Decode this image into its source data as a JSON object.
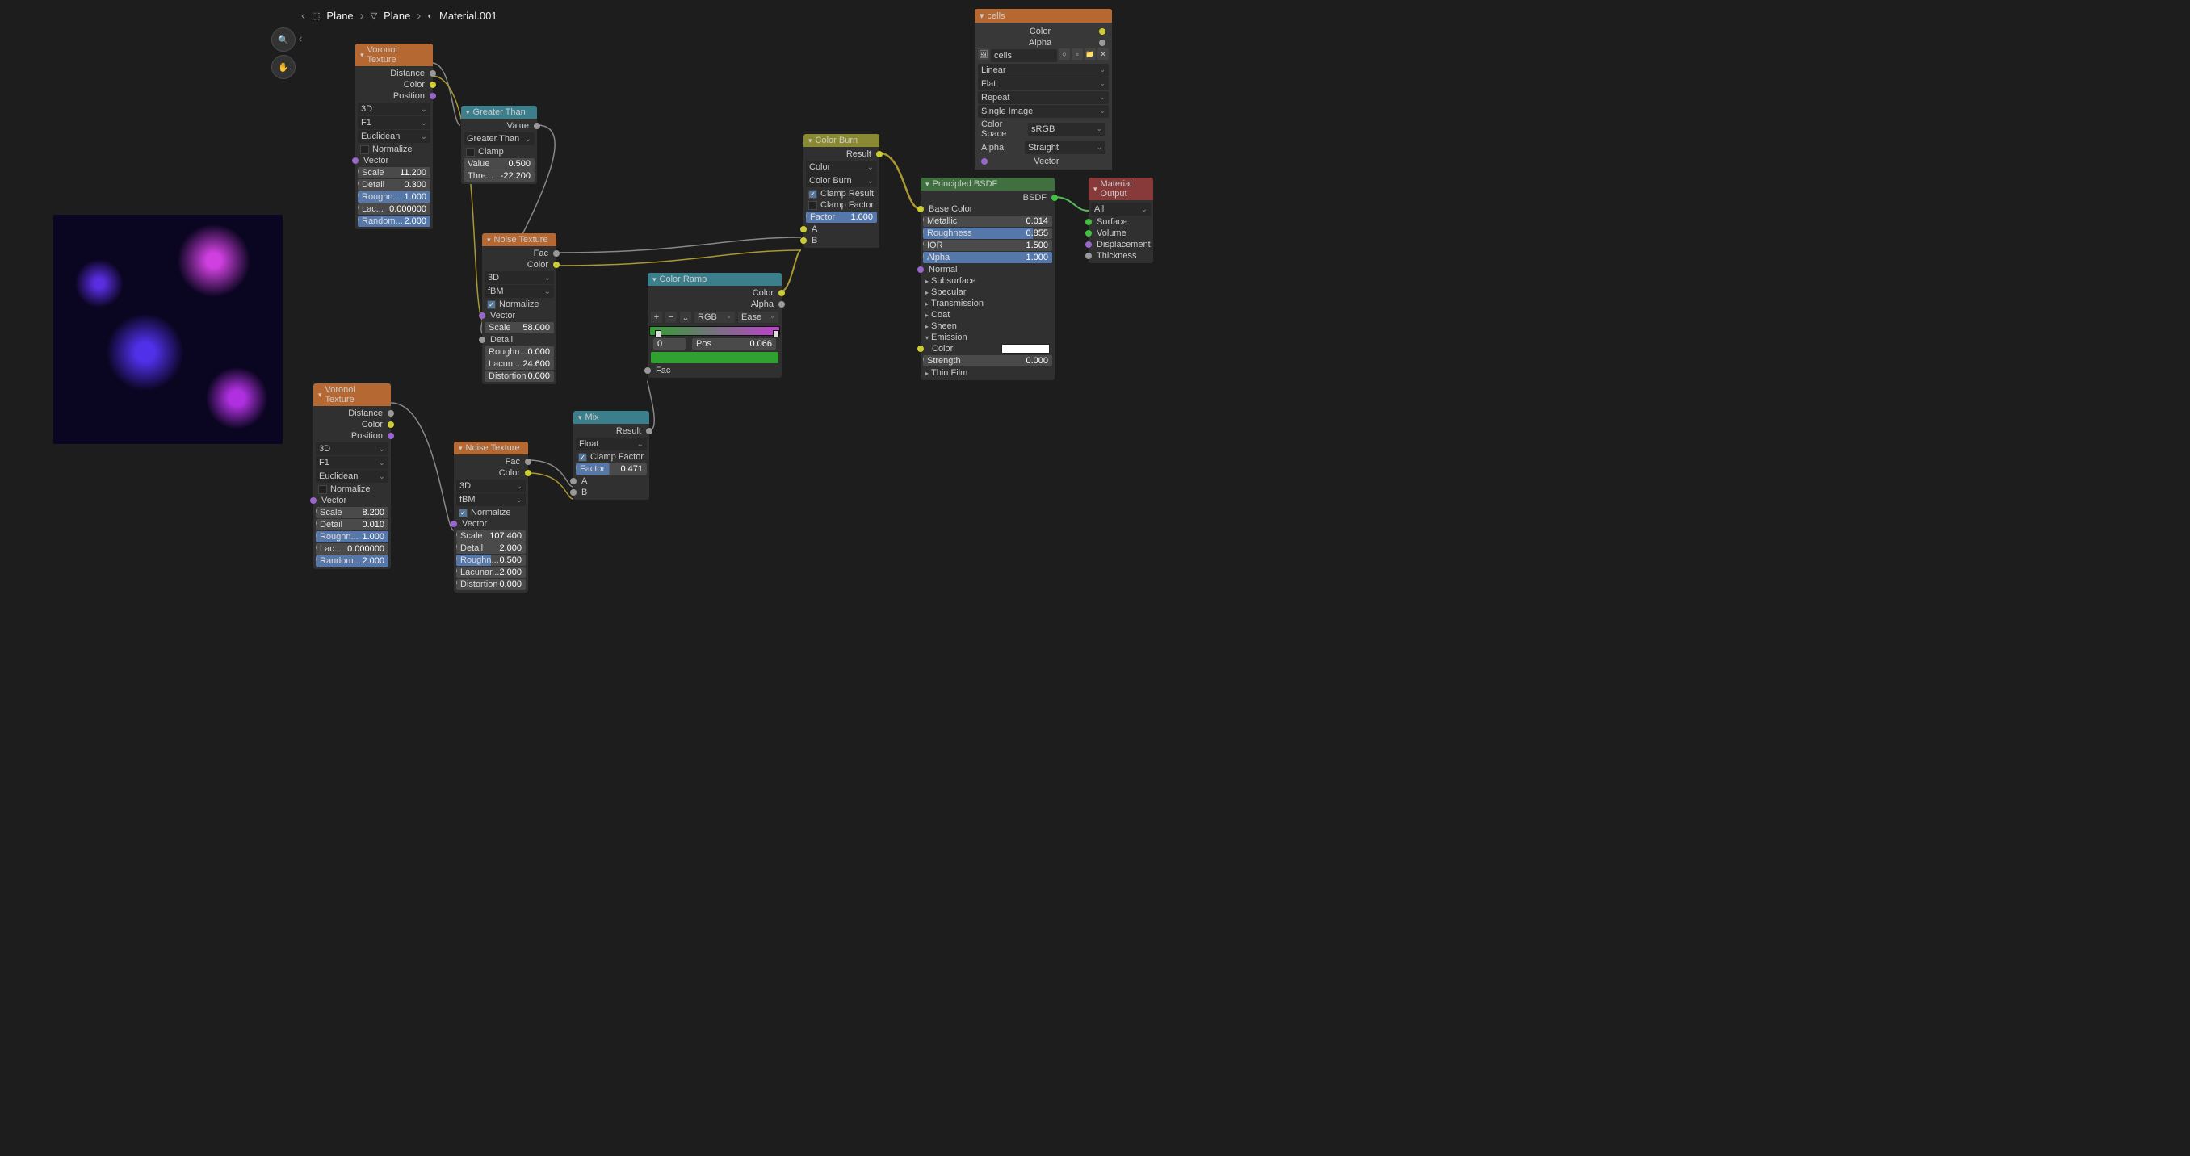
{
  "breadcrumb": {
    "item1": "Plane",
    "item2": "Plane",
    "item3": "Material.001"
  },
  "panel": {
    "title": "cells",
    "color_lbl": "Color",
    "alpha_lbl": "Alpha",
    "image_name": "cells",
    "interp": "Linear",
    "proj": "Flat",
    "ext": "Repeat",
    "frame": "Single Image",
    "cs_lbl": "Color Space",
    "cs_val": "sRGB",
    "alpha_mode_lbl": "Alpha",
    "alpha_mode_val": "Straight",
    "vector_lbl": "Vector"
  },
  "voronoi1": {
    "title": "Voronoi Texture",
    "distance": "Distance",
    "color": "Color",
    "position": "Position",
    "dim": "3D",
    "feat": "F1",
    "metric": "Euclidean",
    "normalize": "Normalize",
    "vector": "Vector",
    "scale_lbl": "Scale",
    "scale": "11.200",
    "detail_lbl": "Detail",
    "detail": "0.300",
    "rough_lbl": "Roughn...",
    "rough": "1.000",
    "lac_lbl": "Lac...",
    "lac": "0.000000",
    "rand_lbl": "Random...",
    "rand": "2.000"
  },
  "voronoi2": {
    "title": "Voronoi Texture",
    "distance": "Distance",
    "color": "Color",
    "position": "Position",
    "dim": "3D",
    "feat": "F1",
    "metric": "Euclidean",
    "normalize": "Normalize",
    "vector": "Vector",
    "scale_lbl": "Scale",
    "scale": "8.200",
    "detail_lbl": "Detail",
    "detail": "0.010",
    "rough_lbl": "Roughn...",
    "rough": "1.000",
    "lac_lbl": "Lac...",
    "lac": "0.000000",
    "rand_lbl": "Random...",
    "rand": "2.000"
  },
  "gt": {
    "title": "Greater Than",
    "value": "Value",
    "op": "Greater Than",
    "clamp": "Clamp",
    "val_lbl": "Value",
    "val": "0.500",
    "thr_lbl": "Thre...",
    "thr": "-22.200"
  },
  "noise1": {
    "title": "Noise Texture",
    "fac": "Fac",
    "color": "Color",
    "dim": "3D",
    "type": "fBM",
    "normalize": "Normalize",
    "vector": "Vector",
    "scale_lbl": "Scale",
    "scale": "58.000",
    "detail_lbl": "Detail",
    "rough_lbl": "Roughn...",
    "rough": "0.000",
    "lac_lbl": "Lacun...",
    "lac": "24.600",
    "dist_lbl": "Distortion",
    "dist": "0.000"
  },
  "noise2": {
    "title": "Noise Texture",
    "fac": "Fac",
    "color": "Color",
    "dim": "3D",
    "type": "fBM",
    "normalize": "Normalize",
    "vector": "Vector",
    "scale_lbl": "Scale",
    "scale": "107.400",
    "detail_lbl": "Detail",
    "detail": "2.000",
    "rough_lbl": "Roughn...",
    "rough": "0.500",
    "lac_lbl": "Lacunar...",
    "lac": "2.000",
    "dist_lbl": "Distortion",
    "dist": "0.000"
  },
  "burn": {
    "title": "Color Burn",
    "result": "Result",
    "mode": "Color",
    "blend": "Color Burn",
    "cr": "Clamp Result",
    "cf": "Clamp Factor",
    "fac_lbl": "Factor",
    "fac": "1.000",
    "a": "A",
    "b": "B"
  },
  "mix": {
    "title": "Mix",
    "result": "Result",
    "type": "Float",
    "cf": "Clamp Factor",
    "fac_lbl": "Factor",
    "fac": "0.471",
    "a": "A",
    "b": "B"
  },
  "ramp": {
    "title": "Color Ramp",
    "color": "Color",
    "alpha": "Alpha",
    "mode": "RGB",
    "interp": "Ease",
    "slot": "0",
    "pos_lbl": "Pos",
    "pos": "0.066",
    "fac": "Fac"
  },
  "bsdf": {
    "title": "Principled BSDF",
    "bsdf": "BSDF",
    "all": "All",
    "base": "Base Color",
    "met_lbl": "Metallic",
    "met": "0.014",
    "rough_lbl": "Roughness",
    "rough": "0.855",
    "ior_lbl": "IOR",
    "ior": "1.500",
    "alpha_lbl": "Alpha",
    "alpha": "1.000",
    "normal": "Normal",
    "ss": "Subsurface",
    "spec": "Specular",
    "trans": "Transmission",
    "coat": "Coat",
    "sheen": "Sheen",
    "emis": "Emission",
    "color_lbl": "Color",
    "str_lbl": "Strength",
    "str": "0.000",
    "film": "Thin Film"
  },
  "out": {
    "title": "Material Output",
    "all": "All",
    "surf": "Surface",
    "vol": "Volume",
    "disp": "Displacement",
    "thick": "Thickness"
  }
}
